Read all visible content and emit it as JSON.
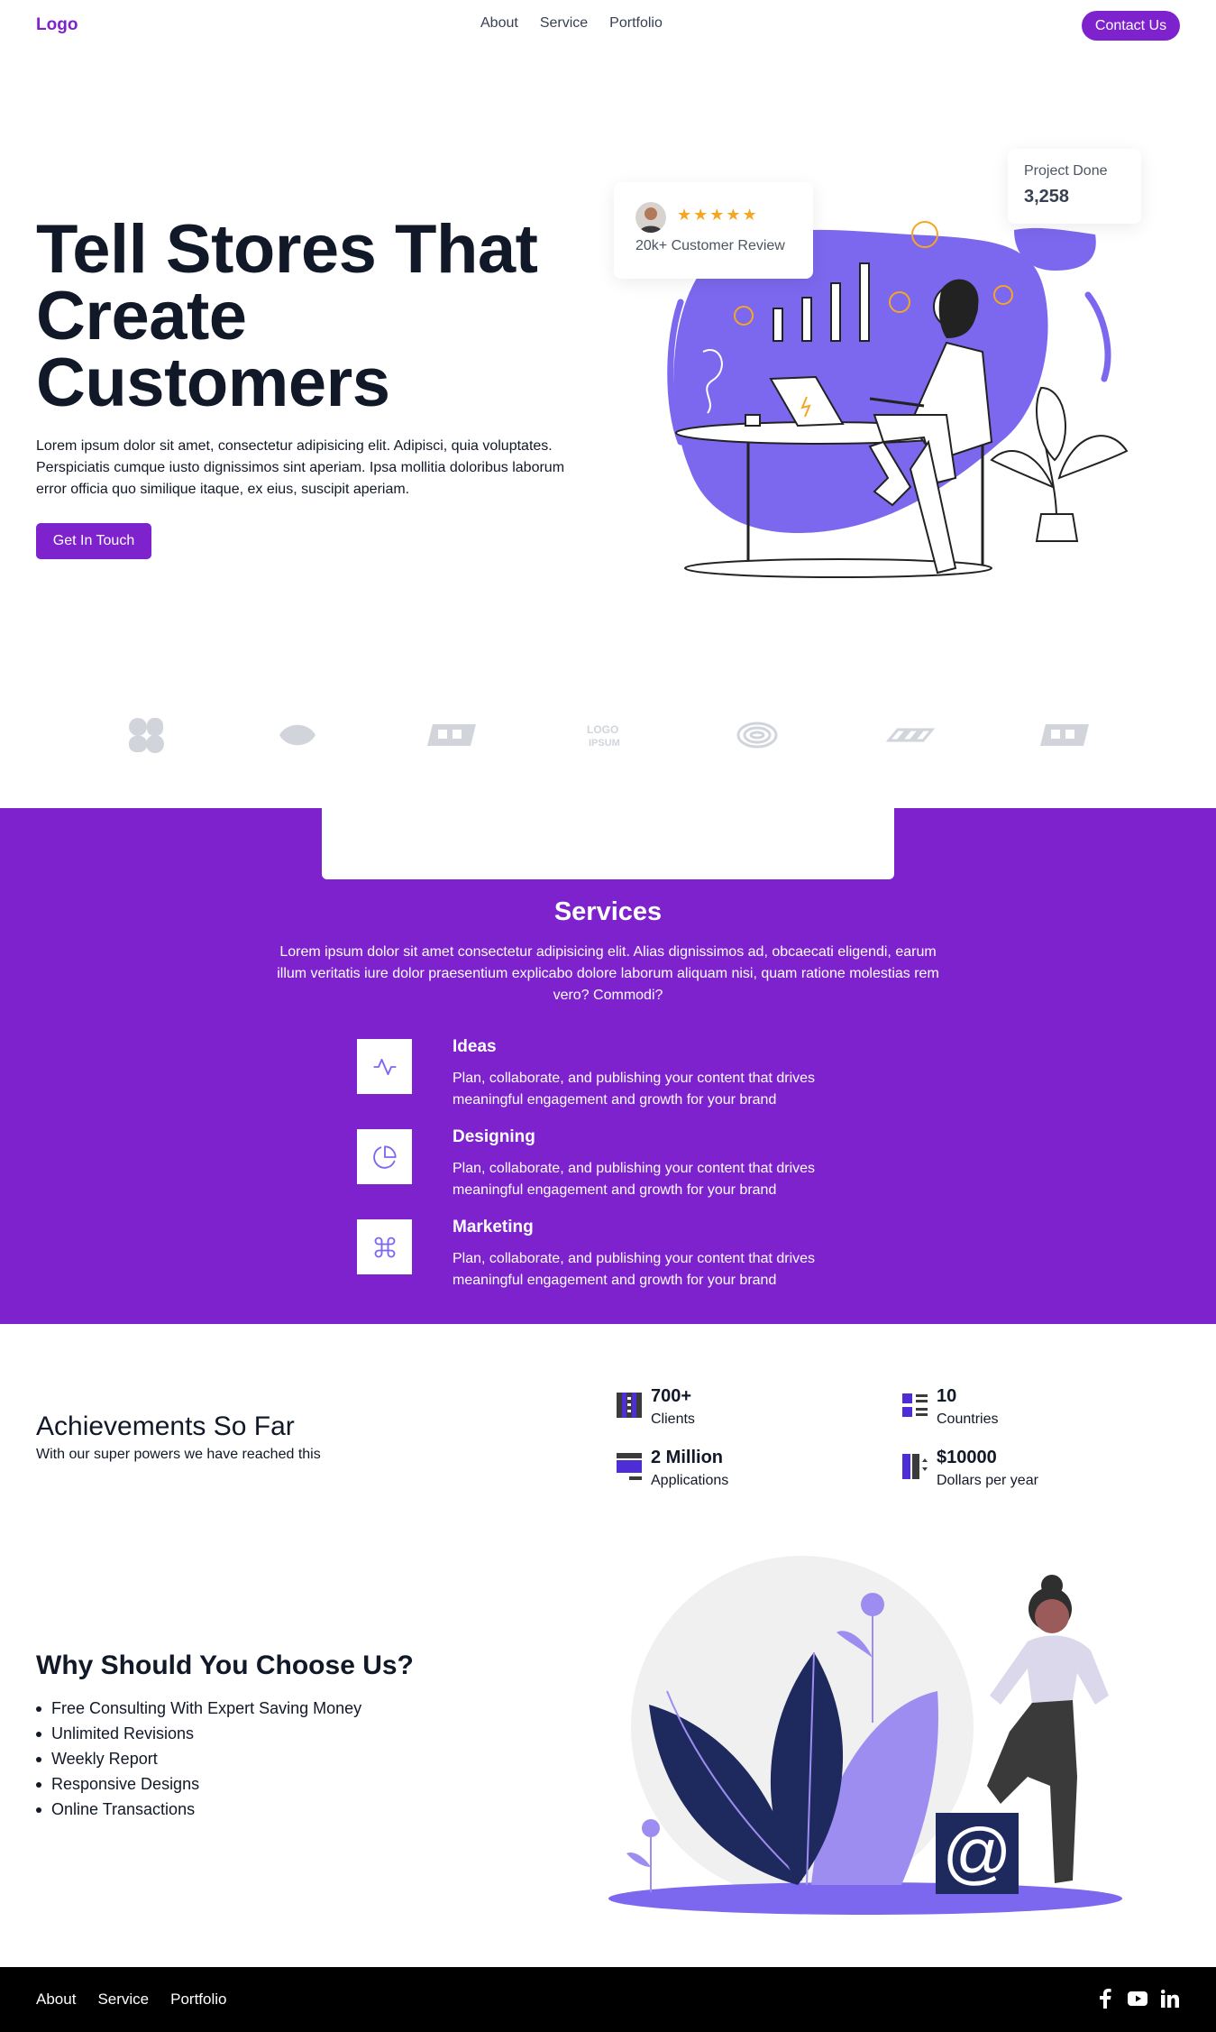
{
  "nav": {
    "logo": "Logo",
    "links": [
      "About",
      "Service",
      "Portfolio"
    ],
    "contact": "Contact Us"
  },
  "hero": {
    "title": "Tell Stores That Create Customers",
    "text": "Lorem ipsum dolor sit amet, consectetur adipisicing elit. Adipisci, quia voluptates. Perspiciatis cumque iusto dignissimos sint aperiam. Ipsa mollitia doloribus laborum error officia quo similique itaque, ex eius, suscipit aperiam.",
    "button": "Get In Touch",
    "review": {
      "stars": "★★★★★",
      "label": "20k+ Customer Review"
    },
    "project": {
      "label": "Project Done",
      "value": "3,258"
    }
  },
  "services": {
    "title": "Services",
    "desc": "Lorem ipsum dolor sit amet consectetur adipisicing elit. Alias dignissimos ad, obcaecati eligendi, earum illum veritatis iure dolor praesentium explicabo dolore laborum aliquam nisi, quam ratione molestias rem vero? Commodi?",
    "items": [
      {
        "name": "Ideas",
        "text": "Plan, collaborate, and publishing your content that drives meaningful engagement and growth for your brand",
        "icon": "activity-icon"
      },
      {
        "name": "Designing",
        "text": "Plan, collaborate, and publishing your content that drives meaningful engagement and growth for your brand",
        "icon": "pie-chart-icon"
      },
      {
        "name": "Marketing",
        "text": "Plan, collaborate, and publishing your content that drives meaningful engagement and growth for your brand",
        "icon": "command-icon"
      }
    ]
  },
  "achievements": {
    "title": "Achievements So Far",
    "subtitle": "With our super powers we have reached this",
    "stats": [
      {
        "value": "700+",
        "label": "Clients"
      },
      {
        "value": "10",
        "label": "Countries"
      },
      {
        "value": "2 Million",
        "label": "Applications"
      },
      {
        "value": "$10000",
        "label": "Dollars per year"
      }
    ]
  },
  "why": {
    "title": "Why Should You Choose Us?",
    "items": [
      "Free Consulting With Expert Saving Money",
      "Unlimited Revisions",
      "Weekly Report",
      "Responsive Designs",
      "Online Transactions"
    ]
  },
  "footer": {
    "links": [
      "About",
      "Service",
      "Portfolio"
    ],
    "socials": [
      "facebook-icon",
      "youtube-icon",
      "linkedin-icon"
    ]
  },
  "colors": {
    "brand": "#7e22ce",
    "illustration": "#7b68ee",
    "navy": "#1e2a5e"
  }
}
